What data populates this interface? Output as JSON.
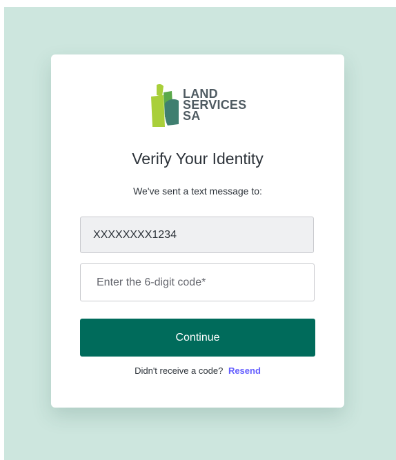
{
  "brand": {
    "line1": "LAND",
    "line2": "SERVICES",
    "line3": "SA",
    "colors": {
      "light_green": "#a9cf3a",
      "mid_green": "#5aa84a",
      "teal": "#3f7f70"
    }
  },
  "page": {
    "title": "Verify Your Identity",
    "subtitle": "We've sent a text message to:"
  },
  "phone": {
    "masked": "XXXXXXXX1234"
  },
  "code": {
    "placeholder": "Enter the 6-digit code*",
    "value": ""
  },
  "actions": {
    "continue_label": "Continue",
    "resend_prompt": "Didn't receive a code?",
    "resend_label": "Resend"
  },
  "colors": {
    "backdrop": "#cde6de",
    "button": "#006b5b",
    "link": "#635dff"
  }
}
